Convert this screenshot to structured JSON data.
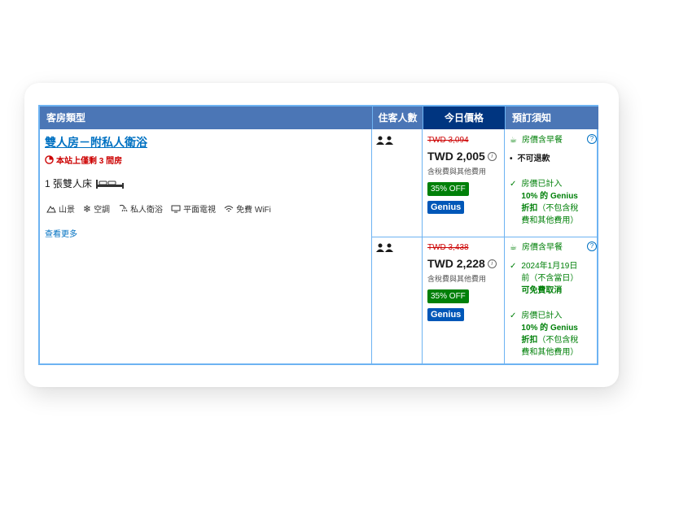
{
  "headers": {
    "room_type": "客房類型",
    "guests": "住客人數",
    "price": "今日價格",
    "policy": "預訂須知"
  },
  "room": {
    "title": "雙人房－附私人衛浴",
    "scarcity": "本站上僅剩 3 間房",
    "bed": "1 張雙人床",
    "amenities": [
      "山景",
      "空調",
      "私人衛浴",
      "平面電視",
      "免費 WiFi"
    ],
    "see_more": "查看更多"
  },
  "offers": [
    {
      "old_price": "TWD 3,094",
      "price": "TWD 2,005",
      "tax": "含稅費與其他費用",
      "discount": "35% OFF",
      "badge": "Genius",
      "breakfast": "房價含早餐",
      "policy1": "不可退款",
      "policy2_a": "房價已計入",
      "policy2_b": "10% 的 Genius",
      "policy2_c": "折扣",
      "policy2_d": "（不包含稅",
      "policy2_e": "費和其他費用）"
    },
    {
      "old_price": "TWD 3,438",
      "price": "TWD 2,228",
      "tax": "含稅費與其他費用",
      "discount": "35% OFF",
      "badge": "Genius",
      "breakfast": "房價含早餐",
      "cancel_a": "2024年1月19日",
      "cancel_b": "前（不含當日）",
      "cancel_c": "可免費取消",
      "policy2_a": "房價已計入",
      "policy2_b": "10% 的 Genius",
      "policy2_c": "折扣",
      "policy2_d": "（不包含稅",
      "policy2_e": "費和其他費用）"
    }
  ],
  "colors": {
    "header": "#4b76b6",
    "price_header": "#003580",
    "border": "#6db3f2",
    "link": "#0071c2",
    "green": "#008009",
    "red": "#cc0000"
  }
}
